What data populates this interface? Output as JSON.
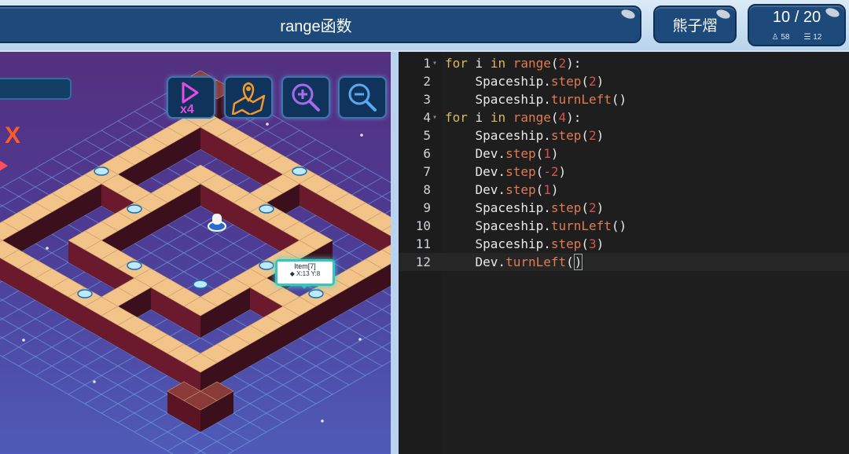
{
  "header": {
    "title": "range函数",
    "user_name": "熊子熠",
    "progress": "10 / 20",
    "stat_a_icon": "♙",
    "stat_a": "58",
    "stat_b_icon": "☰",
    "stat_b": "12"
  },
  "game": {
    "speed_label": "x4",
    "tooltip_title": "Item[7]",
    "tooltip_coords": "◆ X:13 Y:8",
    "x_marker": "X"
  },
  "icons": {
    "play_speed": "play-speed-icon",
    "map": "map-location-icon",
    "zoom_in": "zoom-in-icon",
    "zoom_out": "zoom-out-icon"
  },
  "colors": {
    "accent_pill": "#1d4a7a",
    "game_bg": "#54307f",
    "editor_bg": "#1e1e1e",
    "keyword": "#d9b860",
    "function": "#e07b52",
    "number": "#d6534c"
  },
  "editor": {
    "lines": [
      {
        "n": "1",
        "fold": "▾",
        "tokens": [
          [
            "kw",
            "for"
          ],
          [
            "t",
            " i "
          ],
          [
            "kw",
            "in"
          ],
          [
            "t",
            " "
          ],
          [
            "fn",
            "range"
          ],
          [
            "t",
            "("
          ],
          [
            "num",
            "2"
          ],
          [
            "t",
            "):"
          ]
        ]
      },
      {
        "n": "2",
        "fold": "",
        "tokens": [
          [
            "t",
            "    Spaceship."
          ],
          [
            "fn",
            "step"
          ],
          [
            "t",
            "("
          ],
          [
            "num",
            "2"
          ],
          [
            "t",
            ")"
          ]
        ]
      },
      {
        "n": "3",
        "fold": "",
        "tokens": [
          [
            "t",
            "    Spaceship."
          ],
          [
            "fn",
            "turnLeft"
          ],
          [
            "t",
            "()"
          ]
        ]
      },
      {
        "n": "4",
        "fold": "▾",
        "tokens": [
          [
            "kw",
            "for"
          ],
          [
            "t",
            " i "
          ],
          [
            "kw",
            "in"
          ],
          [
            "t",
            " "
          ],
          [
            "fn",
            "range"
          ],
          [
            "t",
            "("
          ],
          [
            "num",
            "4"
          ],
          [
            "t",
            "):"
          ]
        ]
      },
      {
        "n": "5",
        "fold": "",
        "tokens": [
          [
            "t",
            "    Spaceship."
          ],
          [
            "fn",
            "step"
          ],
          [
            "t",
            "("
          ],
          [
            "num",
            "2"
          ],
          [
            "t",
            ")"
          ]
        ]
      },
      {
        "n": "6",
        "fold": "",
        "tokens": [
          [
            "t",
            "    Dev."
          ],
          [
            "fn",
            "step"
          ],
          [
            "t",
            "("
          ],
          [
            "num",
            "1"
          ],
          [
            "t",
            ")"
          ]
        ]
      },
      {
        "n": "7",
        "fold": "",
        "tokens": [
          [
            "t",
            "    Dev."
          ],
          [
            "fn",
            "step"
          ],
          [
            "t",
            "("
          ],
          [
            "num",
            "-2"
          ],
          [
            "t",
            ")"
          ]
        ]
      },
      {
        "n": "8",
        "fold": "",
        "tokens": [
          [
            "t",
            "    Dev."
          ],
          [
            "fn",
            "step"
          ],
          [
            "t",
            "("
          ],
          [
            "num",
            "1"
          ],
          [
            "t",
            ")"
          ]
        ]
      },
      {
        "n": "9",
        "fold": "",
        "tokens": [
          [
            "t",
            "    Spaceship."
          ],
          [
            "fn",
            "step"
          ],
          [
            "t",
            "("
          ],
          [
            "num",
            "2"
          ],
          [
            "t",
            ")"
          ]
        ]
      },
      {
        "n": "10",
        "fold": "",
        "tokens": [
          [
            "t",
            "    Spaceship."
          ],
          [
            "fn",
            "turnLeft"
          ],
          [
            "t",
            "()"
          ]
        ]
      },
      {
        "n": "11",
        "fold": "",
        "tokens": [
          [
            "t",
            "    Spaceship."
          ],
          [
            "fn",
            "step"
          ],
          [
            "t",
            "("
          ],
          [
            "num",
            "3"
          ],
          [
            "t",
            ")"
          ]
        ]
      },
      {
        "n": "12",
        "fold": "",
        "tokens": [
          [
            "t",
            "    Dev."
          ],
          [
            "fn",
            "turnLeft"
          ],
          [
            "t",
            "("
          ],
          [
            "cur",
            ")"
          ]
        ]
      }
    ]
  }
}
